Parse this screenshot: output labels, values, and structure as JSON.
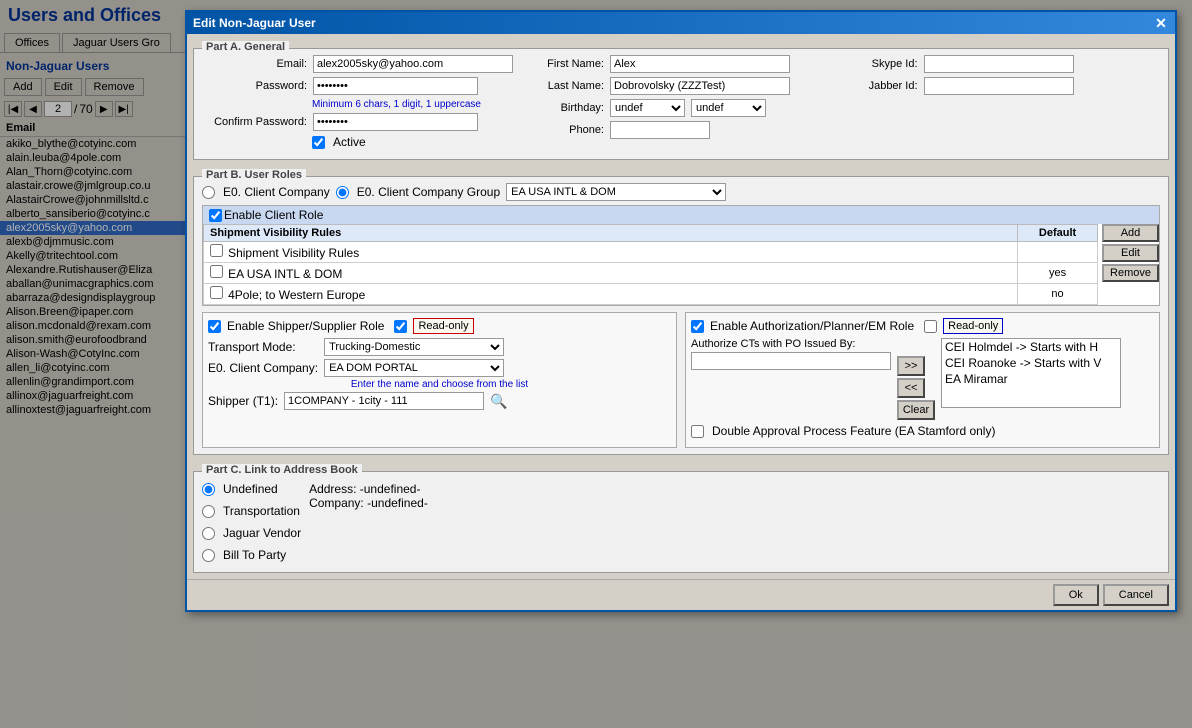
{
  "app": {
    "title": "Users and Offices"
  },
  "sidebar": {
    "tabs": [
      {
        "label": "Offices",
        "active": false
      },
      {
        "label": "Jaguar Users Gro",
        "active": false
      }
    ],
    "section_title": "Non-Jaguar Users",
    "buttons": [
      "Add",
      "Edit",
      "Remove"
    ],
    "pagination": {
      "current": "2",
      "total": "70"
    },
    "col_header": "Email",
    "items": [
      "akiko_blythe@cotyinc.com",
      "alain.leuba@4pole.com",
      "Alan_Thorn@cotyinc.com",
      "alastair.crowe@jmlgroup.co.u",
      "AlastairCrowe@johnmillsltd.c",
      "alberto_sansiberio@cotyinc.c",
      "alex2005sky@yahoo.com",
      "alexb@djmmusic.com",
      "Akelly@tritechtool.com",
      "Alexandre.Rutishauser@Eliza",
      "aballan@unimacgraphics.com",
      "abarraza@designdisplaygroup",
      "Alison.Breen@ipaper.com",
      "alison.mcdonald@rexam.com",
      "alison.smith@eurofoodbrand",
      "Alison-Wash@CotyInc.com",
      "allen_li@cotyinc.com",
      "allenlin@grandimport.com",
      "allinox@jaguarfreight.com",
      "allinoxtest@jaguarfreight.com"
    ],
    "selected_index": 6
  },
  "modal": {
    "title": "Edit Non-Jaguar User",
    "part_a": {
      "legend": "Part A. General",
      "email_label": "Email:",
      "email_value": "alex2005sky@yahoo.com",
      "password_label": "Password:",
      "password_value": "••••••••",
      "password_hint": "Minimum 6 chars, 1 digit, 1 uppercase",
      "confirm_password_label": "Confirm Password:",
      "confirm_password_value": "••••••••",
      "active_label": "Active",
      "active_checked": true,
      "first_name_label": "First Name:",
      "first_name_value": "Alex",
      "last_name_label": "Last Name:",
      "last_name_value": "Dobrovolsky (ZZZTest)",
      "birthday_label": "Birthday:",
      "birthday_val1": "undef",
      "birthday_val2": "undef",
      "phone_label": "Phone:",
      "phone_value": "",
      "skype_label": "Skype Id:",
      "skype_value": "",
      "jabber_label": "Jabber Id:",
      "jabber_value": ""
    },
    "part_b": {
      "legend": "Part B. User Roles",
      "radio1": "E0. Client Company",
      "radio2": "E0. Client Company Group",
      "dropdown_value": "EA USA INTL & DOM",
      "enable_client_role": "Enable Client Role",
      "enable_client_checked": true,
      "table": {
        "col1": "Shipment Visibility Rules",
        "col2": "Default",
        "rows": [
          {
            "name": "Shipment Visibility Rules",
            "value": "",
            "checked": false
          },
          {
            "name": "EA USA INTL & DOM",
            "value": "yes",
            "checked": false
          },
          {
            "name": "4Pole; to Western Europe",
            "value": "no",
            "checked": false
          }
        ]
      },
      "btn_add": "Add",
      "btn_edit": "Edit",
      "btn_remove": "Remove",
      "enable_shipper_label": "Enable Shipper/Supplier Role",
      "enable_shipper_checked": true,
      "readonly_shipper": "Read-only",
      "readonly_shipper_checked": true,
      "transport_mode_label": "Transport Mode:",
      "transport_mode_value": "Trucking-Domestic",
      "e0_client_company_label": "E0. Client Company:",
      "e0_client_company_value": "EA DOM PORTAL",
      "shipper_hint": "Enter the name and choose from the list",
      "shipper_label": "Shipper (T1):",
      "shipper_value": "1COMPANY - 1city - 111",
      "enable_auth_label": "Enable Authorization/Planner/EM Role",
      "enable_auth_checked": true,
      "readonly_auth": "Read-only",
      "readonly_auth_checked": false,
      "authorize_label": "Authorize CTs with PO Issued By:",
      "arrow_btn_right": ">>",
      "arrow_btn_left": "<<",
      "clear_btn": "Clear",
      "auth_list": [
        "CEI Holmdel -> Starts with H",
        "CEI Roanoke -> Starts with V",
        "EA Miramar"
      ],
      "double_approval_label": "Double Approval Process Feature (EA Stamford only)"
    },
    "part_c": {
      "legend": "Part C. Link to Address Book",
      "radio_undefined": "Undefined",
      "radio_transportation": "Transportation",
      "radio_jaguar_vendor": "Jaguar Vendor",
      "radio_bill_to_party": "Bill To Party",
      "selected_radio": "Undefined",
      "address_label": "Address:",
      "address_value": "-undefined-",
      "company_label": "Company:",
      "company_value": "-undefined-"
    },
    "footer": {
      "ok_label": "Ok",
      "cancel_label": "Cancel"
    }
  }
}
